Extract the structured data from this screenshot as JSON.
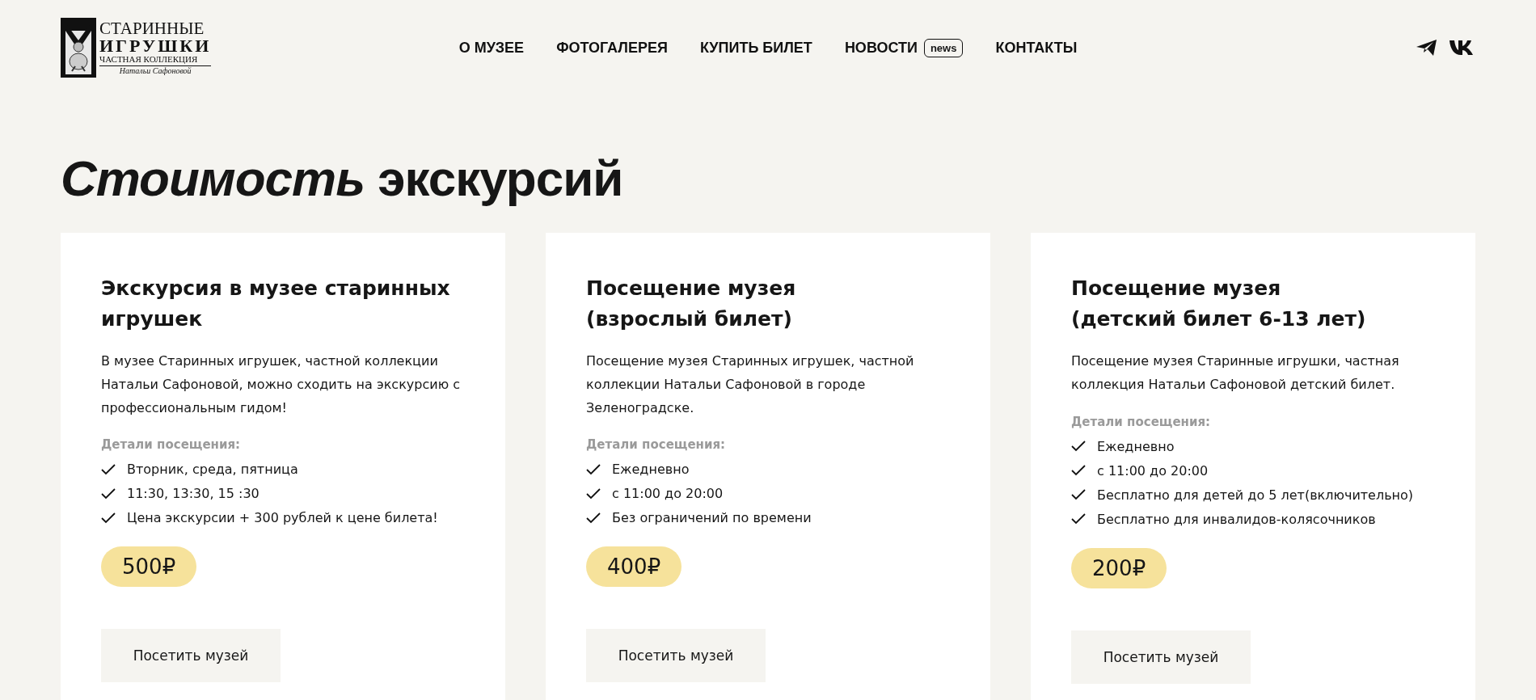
{
  "logo": {
    "lines": [
      "СТАРИННЫЕ",
      "ИГРУШКИ",
      "ЧАСТНАЯ КОЛЛЕКЦИЯ"
    ],
    "signature": "Натальи Сафоновой"
  },
  "nav": [
    {
      "label": "О МУЗЕЕ"
    },
    {
      "label": "ФОТОГАЛЕРЕЯ"
    },
    {
      "label": "КУПИТЬ БИЛЕТ"
    },
    {
      "label": "НОВОСТИ",
      "badge": "news"
    },
    {
      "label": "КОНТАКТЫ"
    }
  ],
  "heading": "*Стоимость* экскурсий",
  "cards": [
    {
      "title": "Экскурсия в музее старинных игрушек",
      "description": "В музее Старинных игрушек, частной коллекции Натальи Сафоновой, можно сходить на экскурсию с профессиональным гидом!",
      "details_label": "Детали посещения:",
      "details": [
        "Вторник, среда, пятница",
        "11:30, 13:30, 15 :30",
        "Цена экскурсии + 300 рублей к цене билета!"
      ],
      "price": "500₽",
      "button": "Посетить музей"
    },
    {
      "title": "Посещение музея\n(взрослый билет)",
      "description": "Посещение музея Старинных игрушек, частной коллекции Натальи Сафоновой в городе Зеленоградске.",
      "details_label": "Детали посещения:",
      "details": [
        "Ежедневно",
        "с 11:00 до 20:00",
        "Без ограничений по времени"
      ],
      "price": "400₽",
      "button": "Посетить музей"
    },
    {
      "title": "Посещение музея\n(детский билет 6-13 лет)",
      "description": "Посещение музея Старинные игрушки, частная коллекция Натальи Сафоновой детский билет.",
      "details_label": "Детали посещения:",
      "details": [
        "Ежедневно",
        "с 11:00 до 20:00",
        "Бесплатно для детей до 5 лет(включительно)",
        "Бесплатно для инвалидов-колясочников"
      ],
      "price": "200₽",
      "button": "Посетить музей"
    }
  ]
}
